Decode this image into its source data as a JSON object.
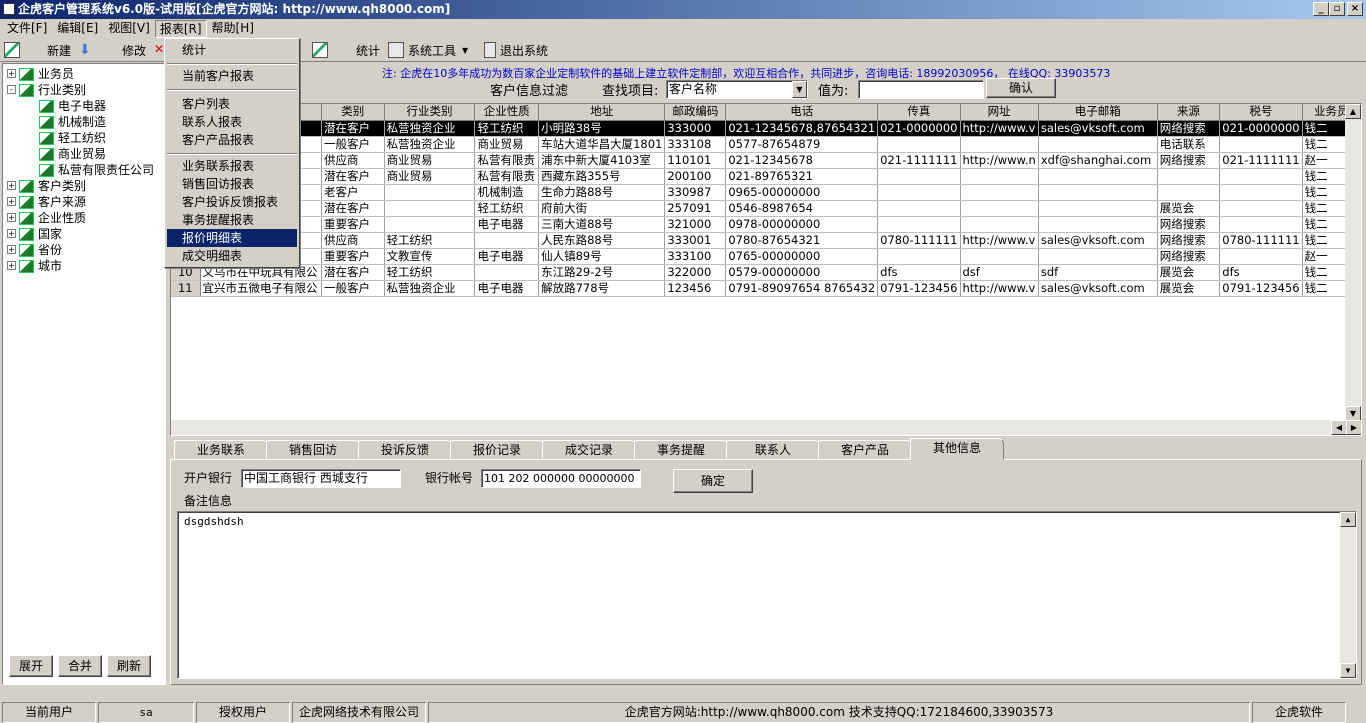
{
  "window": {
    "title": "企虎客户管理系统v6.0版-试用版[企虎官方网站: http://www.qh8000.com]"
  },
  "menubar": [
    "文件[F]",
    "编辑[E]",
    "视图[V]",
    "报表[R]",
    "帮助[H]"
  ],
  "toolbar": {
    "new": "新建",
    "edit": "修改",
    "stats": "统计",
    "sys_tools": "系统工具",
    "exit": "退出系统"
  },
  "report_menu": {
    "items": [
      "统计",
      "当前客户报表",
      "客户列表",
      "联系人报表",
      "客户产品报表",
      "业务联系报表",
      "销售回访报表",
      "客户投诉反馈报表",
      "事务提醒报表",
      "报价明细表",
      "成交明细表"
    ],
    "highlighted": "报价明细表"
  },
  "tree": {
    "nodes": [
      {
        "label": "业务员",
        "level": 0,
        "expander": "+"
      },
      {
        "label": "行业类别",
        "level": 0,
        "expander": "-"
      },
      {
        "label": "电子电器",
        "level": 1,
        "expander": ""
      },
      {
        "label": "机械制造",
        "level": 1,
        "expander": ""
      },
      {
        "label": "轻工纺织",
        "level": 1,
        "expander": ""
      },
      {
        "label": "商业贸易",
        "level": 1,
        "expander": ""
      },
      {
        "label": "私营有限责任公司",
        "level": 1,
        "expander": ""
      },
      {
        "label": "客户类别",
        "level": 0,
        "expander": "+"
      },
      {
        "label": "客户来源",
        "level": 0,
        "expander": "+"
      },
      {
        "label": "企业性质",
        "level": 0,
        "expander": "+"
      },
      {
        "label": "国家",
        "level": 0,
        "expander": "+"
      },
      {
        "label": "省份",
        "level": 0,
        "expander": "+"
      },
      {
        "label": "城市",
        "level": 0,
        "expander": "+"
      }
    ],
    "buttons": {
      "expand": "展开",
      "merge": "合并",
      "refresh": "刷新"
    }
  },
  "filter": {
    "notice": "注: 企虎在10多年成功为数百家企业定制软件的基础上建立软件定制部，欢迎互相合作，共同进步，咨询电话: 18992030956， 在线QQ: 33903573",
    "title": "客户信息过滤",
    "field_label": "查找项目:",
    "field_value": "客户名称",
    "value_label": "值为:",
    "value_input": "",
    "confirm": "确认",
    "notice_color": "#0000cc"
  },
  "grid": {
    "columns": [
      "",
      "类别",
      "行业类别",
      "企业性质",
      "地址",
      "邮政编码",
      "电话",
      "传真",
      "网址",
      "电子邮箱",
      "来源",
      "税号",
      "业务员"
    ],
    "rows": [
      {
        "no": "",
        "name": "公司",
        "type": "潜在客户",
        "industry": "私营独资企业",
        "nature": "轻工纺织",
        "addr": "小明路38号",
        "zip": "333000",
        "phone": "021-12345678,87654321",
        "fax": "021-0000000",
        "web": "http://www.v",
        "email": "sales@vksoft.com",
        "source": "网络搜索",
        "tax": "021-0000000",
        "rep": "钱二",
        "selected": true
      },
      {
        "no": "",
        "name": "",
        "type": "一般客户",
        "industry": "私营独资企业",
        "nature": "商业贸易",
        "addr": "车站大道华昌大厦1801",
        "zip": "333108",
        "phone": "0577-87654879",
        "fax": "",
        "web": "",
        "email": "",
        "source": "电话联系",
        "tax": "",
        "rep": "钱二",
        "selected": false
      },
      {
        "no": "",
        "name": "限公",
        "type": "供应商",
        "industry": "商业贸易",
        "nature": "私营有限责",
        "addr": "浦东中新大厦4103室",
        "zip": "110101",
        "phone": "021-12345678",
        "fax": "021-1111111",
        "web": "http://www.n",
        "email": "xdf@shanghai.com",
        "source": "网络搜索",
        "tax": "021-1111111",
        "rep": "赵一",
        "selected": false
      },
      {
        "no": "",
        "name": "公司",
        "type": "潜在客户",
        "industry": "商业贸易",
        "nature": "私营有限责",
        "addr": "西藏东路355号",
        "zip": "200100",
        "phone": "021-89765321",
        "fax": "",
        "web": "",
        "email": "",
        "source": "",
        "tax": "",
        "rep": "钱二",
        "selected": false
      },
      {
        "no": "",
        "name": "",
        "type": "老客户",
        "industry": "",
        "nature": "机械制造",
        "addr": "生命力路88号",
        "zip": "330987",
        "phone": "0965-00000000",
        "fax": "",
        "web": "",
        "email": "",
        "source": "",
        "tax": "",
        "rep": "钱二",
        "selected": false
      },
      {
        "no": "",
        "name": "限公",
        "type": "潜在客户",
        "industry": "",
        "nature": "轻工纺织",
        "addr": "府前大街",
        "zip": "257091",
        "phone": "0546-8987654",
        "fax": "",
        "web": "",
        "email": "",
        "source": "展览会",
        "tax": "",
        "rep": "钱二",
        "selected": false
      },
      {
        "no": "",
        "name": "",
        "type": "重要客户",
        "industry": "",
        "nature": "电子电器",
        "addr": "三南大道88号",
        "zip": "321000",
        "phone": "0978-00000000",
        "fax": "",
        "web": "",
        "email": "",
        "source": "网络搜索",
        "tax": "",
        "rep": "钱二",
        "selected": false
      },
      {
        "no": "",
        "name": "",
        "type": "供应商",
        "industry": "轻工纺织",
        "nature": "",
        "addr": "人民东路88号",
        "zip": "333001",
        "phone": "0780-87654321",
        "fax": "0780-111111",
        "web": "http://www.v",
        "email": "sales@vksoft.com",
        "source": "网络搜索",
        "tax": "0780-111111",
        "rep": "钱二",
        "selected": false
      },
      {
        "no": "",
        "name": "一",
        "type": "重要客户",
        "industry": "文教宣传",
        "nature": "电子电器",
        "addr": "仙人镇89号",
        "zip": "333100",
        "phone": "0765-00000000",
        "fax": "",
        "web": "",
        "email": "",
        "source": "网络搜索",
        "tax": "",
        "rep": "赵一",
        "selected": false
      },
      {
        "no": "10",
        "name": "义乌市在中玩具有限公",
        "type": "潜在客户",
        "industry": "轻工纺织",
        "nature": "",
        "addr": "东江路29-2号",
        "zip": "322000",
        "phone": "0579-00000000",
        "fax": "dfs",
        "web": "dsf",
        "email": "sdf",
        "source": "展览会",
        "tax": "dfs",
        "rep": "钱二",
        "selected": false
      },
      {
        "no": "11",
        "name": "宜兴市五微电子有限公",
        "type": "一般客户",
        "industry": "私营独资企业",
        "nature": "电子电器",
        "addr": "解放路778号",
        "zip": "123456",
        "phone": "0791-89097654 8765432",
        "fax": "0791-123456",
        "web": "http://www.v",
        "email": "sales@vksoft.com",
        "source": "展览会",
        "tax": "0791-123456",
        "rep": "钱二",
        "selected": false
      }
    ]
  },
  "tabs": {
    "items": [
      "业务联系",
      "销售回访",
      "投诉反馈",
      "报价记录",
      "成交记录",
      "事务提醒",
      "联系人",
      "客户产品",
      "其他信息"
    ],
    "active": 8
  },
  "detail": {
    "bank_label": "开户银行",
    "bank_value": "中国工商银行 西城支行",
    "account_label": "银行帐号",
    "account_value": "101 202 000000 00000000",
    "confirm": "确定",
    "remarks_label": "备注信息",
    "remarks_value": "dsgdshdsh"
  },
  "status": {
    "current_user_label": "当前用户",
    "current_user": "sa",
    "licensed_label": "授权用户",
    "licensed_to": "企虎网络技术有限公司",
    "site_support": "企虎官方网站:http://www.qh8000.com  技术支持QQ:172184600,33903573",
    "brand": "企虎软件"
  },
  "colors": {
    "title_bar_start": "#0a246a",
    "title_bar_end": "#a6caf0",
    "face": "#d4d0c8",
    "menu_highlight": "#0a246a",
    "selected_row": "#000000"
  }
}
